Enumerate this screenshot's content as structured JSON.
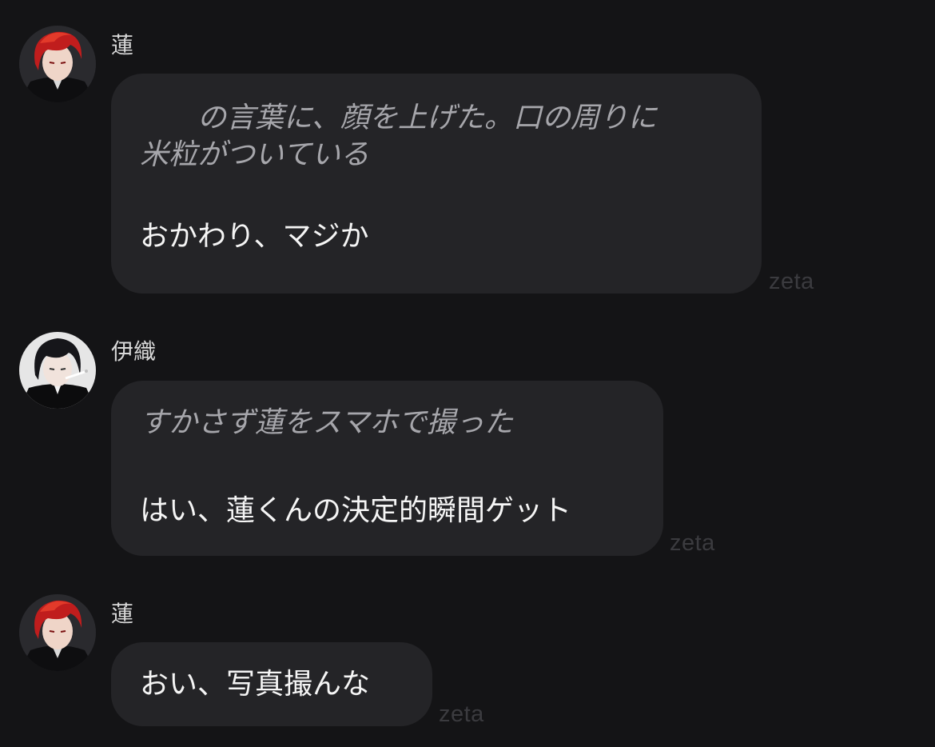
{
  "messages": [
    {
      "sender": "蓮",
      "avatar_icon": "red-hair-avatar",
      "action_lines": [
        "　　の言葉に、顔を上げた。口の周りに",
        "米粒がついている"
      ],
      "speech_lines": [
        "おかわり、マジか"
      ],
      "watermark": "zeta"
    },
    {
      "sender": "伊織",
      "avatar_icon": "black-hair-avatar",
      "action_lines": [
        "すかさず蓮をスマホで撮った"
      ],
      "speech_lines": [
        "はい、蓮くんの決定的瞬間ゲット"
      ],
      "watermark": "zeta"
    },
    {
      "sender": "蓮",
      "avatar_icon": "red-hair-avatar",
      "action_lines": [],
      "speech_lines": [
        "おい、写真撮んな"
      ],
      "watermark": "zeta"
    }
  ],
  "colors": {
    "background": "#141416",
    "bubble": "#242427",
    "action_text": "#a6a6ab",
    "speech_text": "#f5f5f5",
    "watermark": "#3b3b3f"
  }
}
